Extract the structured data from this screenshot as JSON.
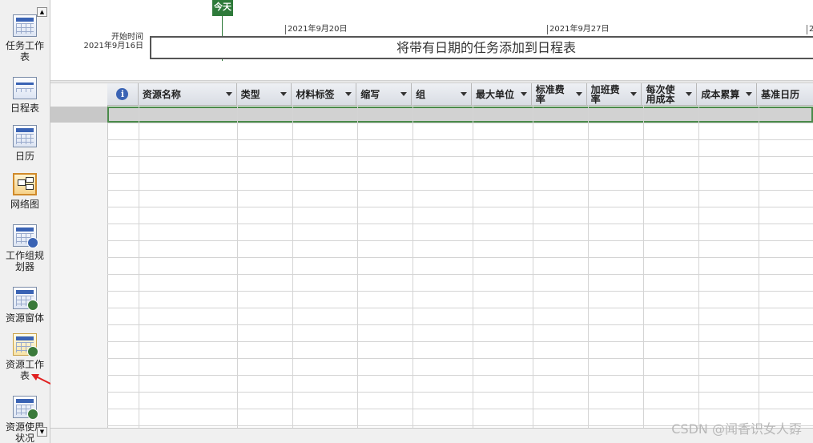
{
  "view_bar": {
    "items": [
      {
        "label": "任务工作表",
        "icon": "gantt-sheet-icon"
      },
      {
        "label": "日程表",
        "icon": "timeline-icon"
      },
      {
        "label": "日历",
        "icon": "calendar-icon"
      },
      {
        "label": "网络图",
        "icon": "network-diagram-icon"
      },
      {
        "label": "工作组规划器",
        "icon": "team-planner-icon"
      },
      {
        "label": "资源窗体",
        "icon": "resource-form-icon"
      },
      {
        "label": "资源工作表",
        "icon": "resource-sheet-icon"
      },
      {
        "label": "资源使用状况",
        "icon": "resource-usage-icon"
      }
    ]
  },
  "timeline": {
    "today_label": "今天",
    "start_label": "开始时间",
    "start_date": "2021年9月16日",
    "date_ticks": [
      "2021年9月20日",
      "2021年9月27日",
      "2"
    ],
    "empty_message": "将带有日期的任务添加到日程表"
  },
  "sheet": {
    "info_icon": "i",
    "columns": [
      "资源名称",
      "类型",
      "材料标签",
      "缩写",
      "组",
      "最大单位",
      "标准费率",
      "加班费率",
      "每次使用成本",
      "成本累算",
      "基准日历"
    ]
  },
  "watermark": "CSDN @闻香识女人孬",
  "colors": {
    "today": "#2e7a3a",
    "selected_border": "#4a8a4a",
    "annotation_arrow": "#e02020"
  }
}
